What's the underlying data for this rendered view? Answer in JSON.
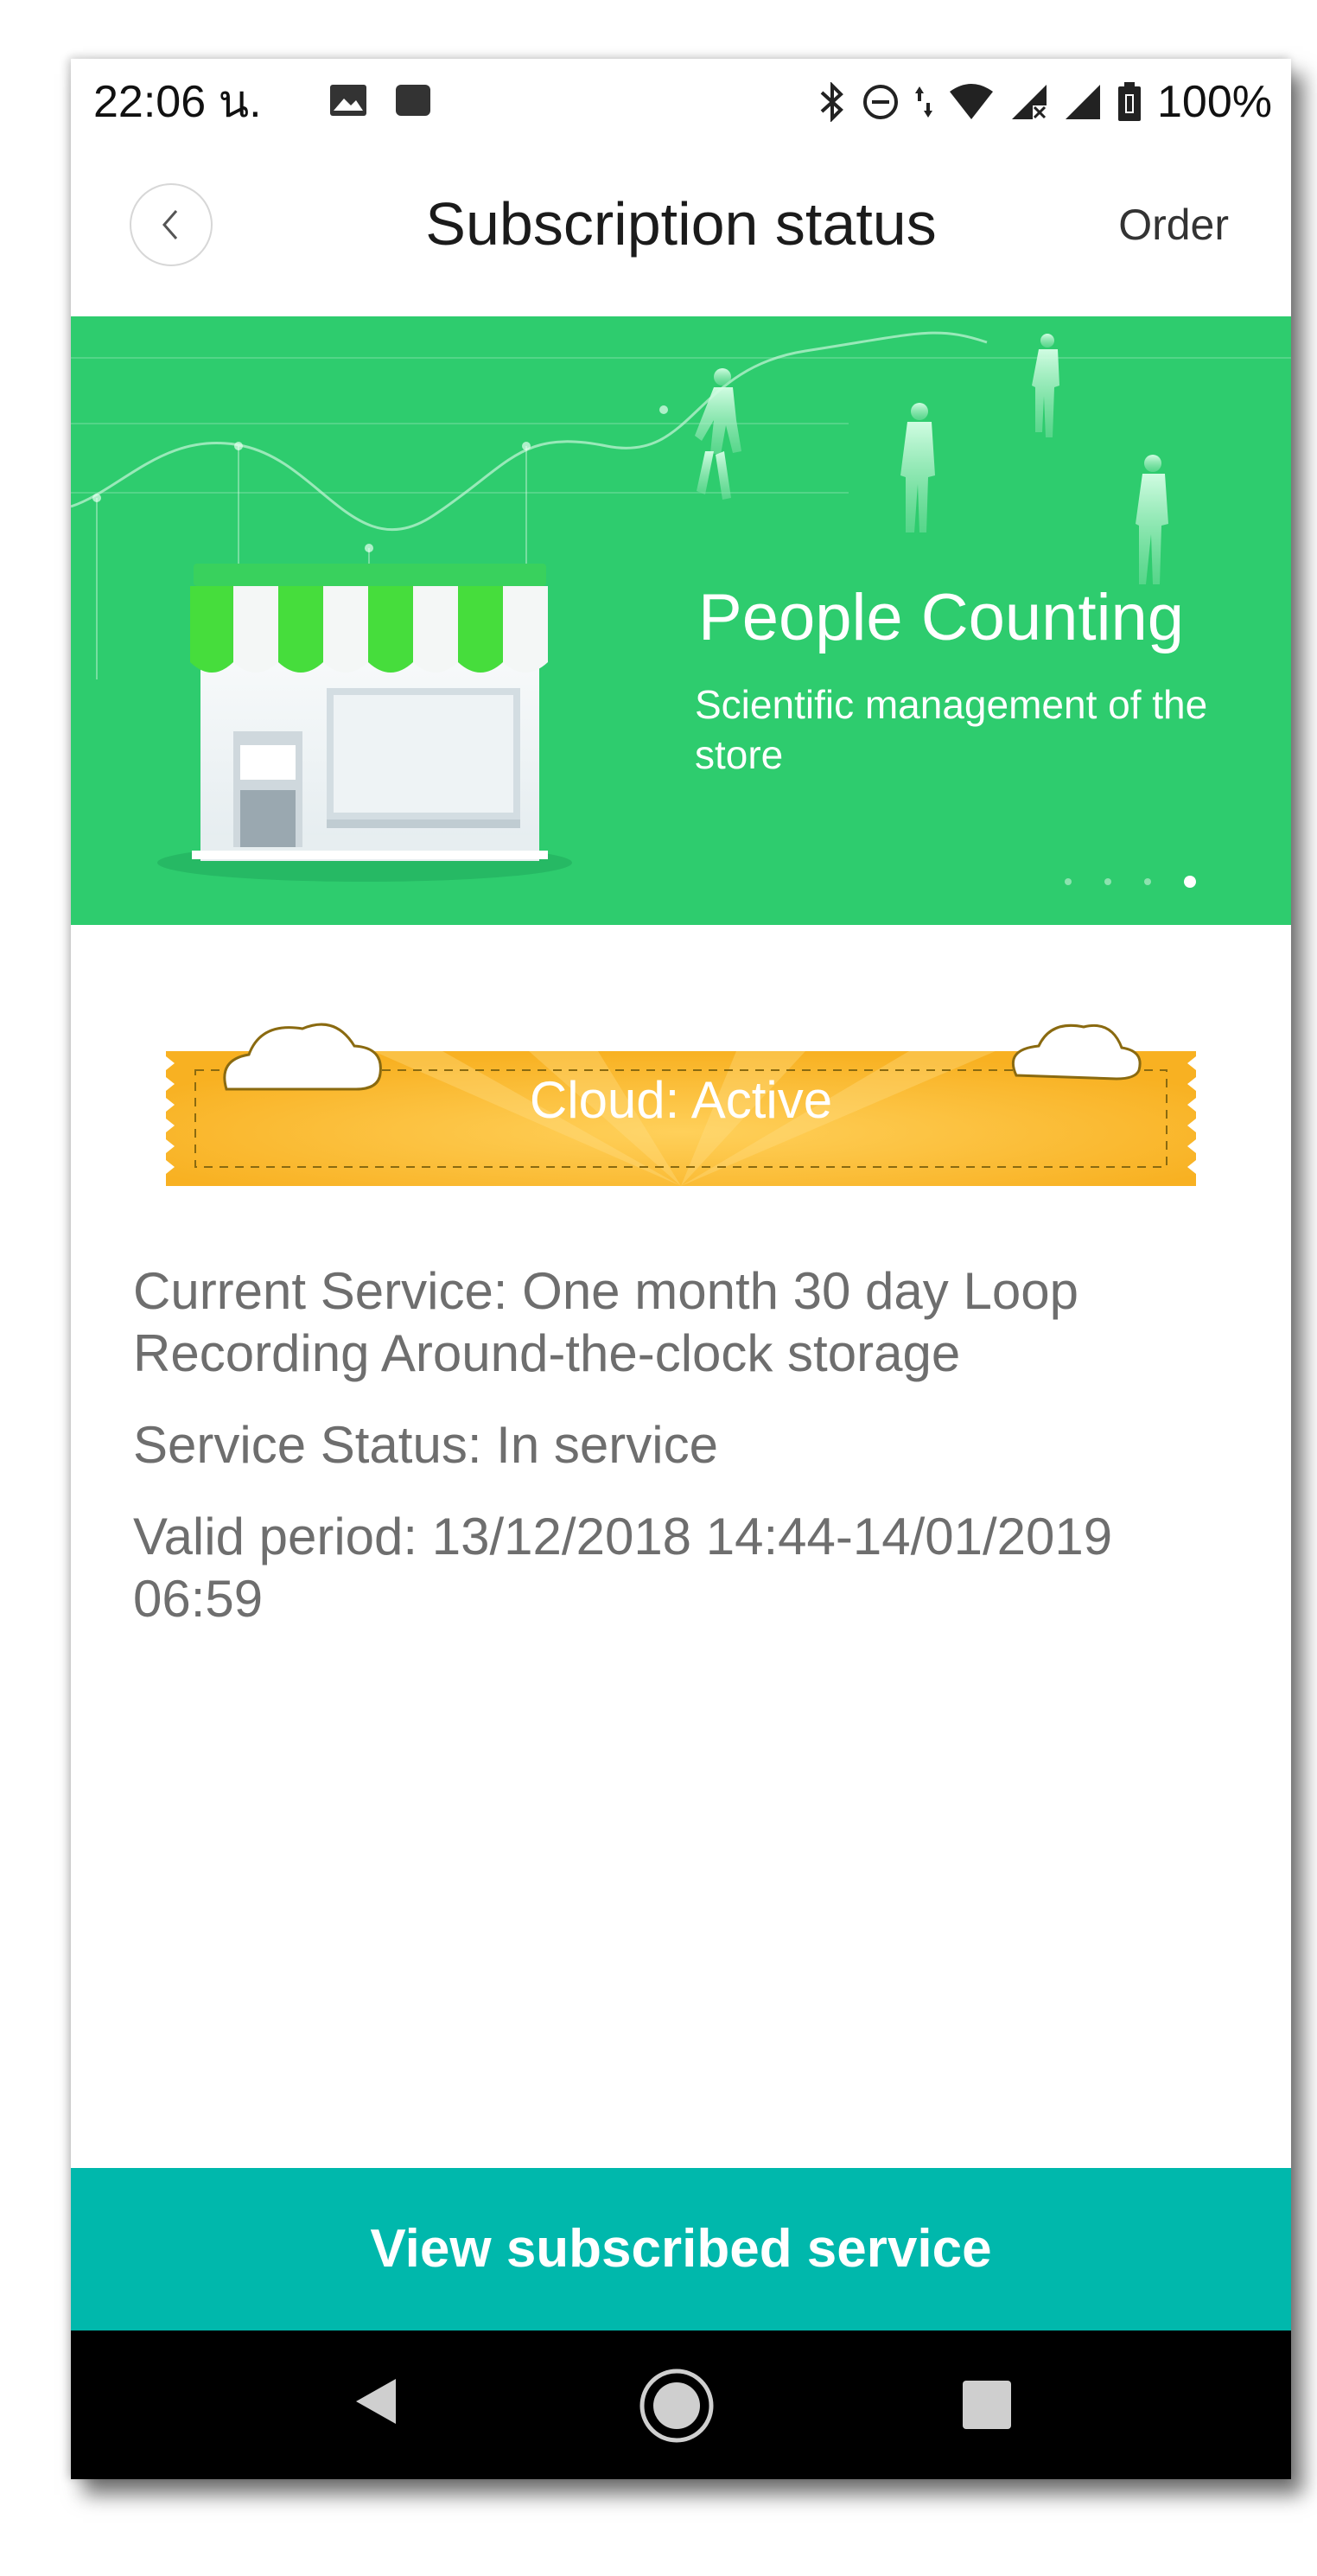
{
  "status_bar": {
    "time": "22:06 น.",
    "battery": "100%",
    "icons": [
      "image-icon",
      "app-icon",
      "bluetooth-icon",
      "do-not-disturb-icon",
      "data-arrows-icon",
      "wifi-icon",
      "signal-icon",
      "signal-icon",
      "battery-icon"
    ]
  },
  "header": {
    "title": "Subscription status",
    "order_label": "Order",
    "back_icon": "chevron-left-icon"
  },
  "banner": {
    "title": "People Counting",
    "subtitle": "Scientific management of the store",
    "slides": 4,
    "active_slide": 4,
    "background": "#2ecc6e"
  },
  "ticket": {
    "label": "Cloud: Active",
    "color": "#f9b62a"
  },
  "service": {
    "current_service": "Current Service: One month 30 day Loop Recording Around-the-clock storage",
    "status": "Service Status: In service",
    "valid_period": "Valid period: 13/12/2018 14:44-14/01/2019 06:59"
  },
  "cta": {
    "label": "View subscribed service",
    "color": "#00b8ac"
  },
  "nav_bar": {
    "buttons": [
      "back-triangle-icon",
      "home-circle-icon",
      "recents-square-icon"
    ]
  }
}
